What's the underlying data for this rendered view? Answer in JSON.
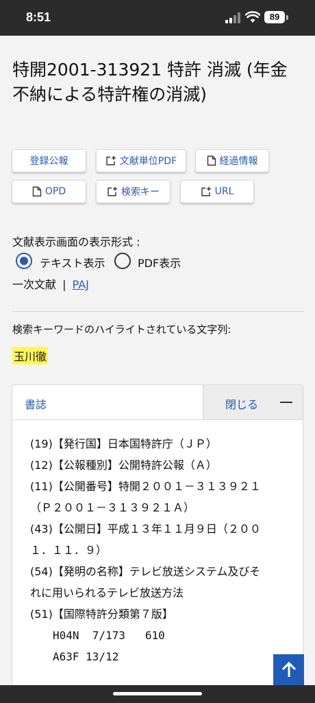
{
  "status_bar": {
    "time": "8:51",
    "battery": "89"
  },
  "title": "特開2001-313921 特許 消滅 (年金不納による特許権の消滅)",
  "buttons": {
    "registration": "登録公報",
    "doc_pdf": "文献単位PDF",
    "progress": "経過情報",
    "opd": "OPD",
    "search_key": "検索キー",
    "url": "URL"
  },
  "display_format": {
    "label": "文献表示画面の表示形式 :",
    "text_option": "テキスト表示",
    "pdf_option": "PDF表示",
    "selected": "テキスト表示"
  },
  "primary_doc": {
    "label": "一次文献",
    "separator": "|",
    "link": "PAJ"
  },
  "highlight": {
    "label": "検索キーワードのハイライトされている文字列:",
    "keyword": "玉川徹"
  },
  "panel": {
    "tab": "書誌",
    "close": "閉じる",
    "lines": [
      "(19)【発行国】日本国特許庁（ＪＰ）",
      "(12)【公報種別】公開特許公報（Ａ）",
      "(11)【公開番号】特開２００１－３１３９２１",
      "（Ｐ２００１－３１３９２１Ａ）",
      "(43)【公開日】平成１３年１１月９日（２００",
      "１．１１．９）",
      "(54)【発明の名称】テレビ放送システム及びそ",
      "れに用いられるテレビ放送方法",
      "(51)【国際特許分類第７版】"
    ],
    "ipc": [
      "H04N  7/173   610",
      "A63F 13/12"
    ]
  },
  "icons": [
    "document-icon",
    "external-link-icon",
    "arrow-up-icon",
    "wifi-icon",
    "signal-icon"
  ],
  "colors": {
    "link": "#2a5ca8",
    "highlight": "#fff55a",
    "scroll_top_button": "#1f5cb8"
  }
}
